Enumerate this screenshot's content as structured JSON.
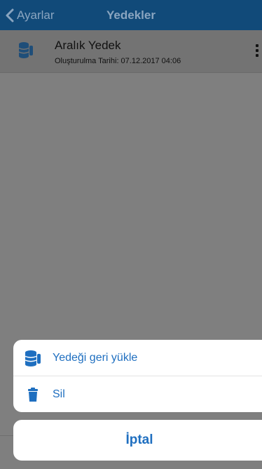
{
  "navbar": {
    "back_label": "Ayarlar",
    "title": "Yedekler"
  },
  "backups": [
    {
      "name": "Aralık Yedek",
      "created": "Oluşturulma Tarihi: 07.12.2017 04:06",
      "icon": "database-icon"
    }
  ],
  "action_sheet": {
    "restore_label": "Yedeği geri yükle",
    "delete_label": "Sil",
    "cancel_label": "İptal"
  },
  "colors": {
    "navbar": "#114a79",
    "accent": "#1f6fc0",
    "overlay": "#7f7f7f"
  }
}
